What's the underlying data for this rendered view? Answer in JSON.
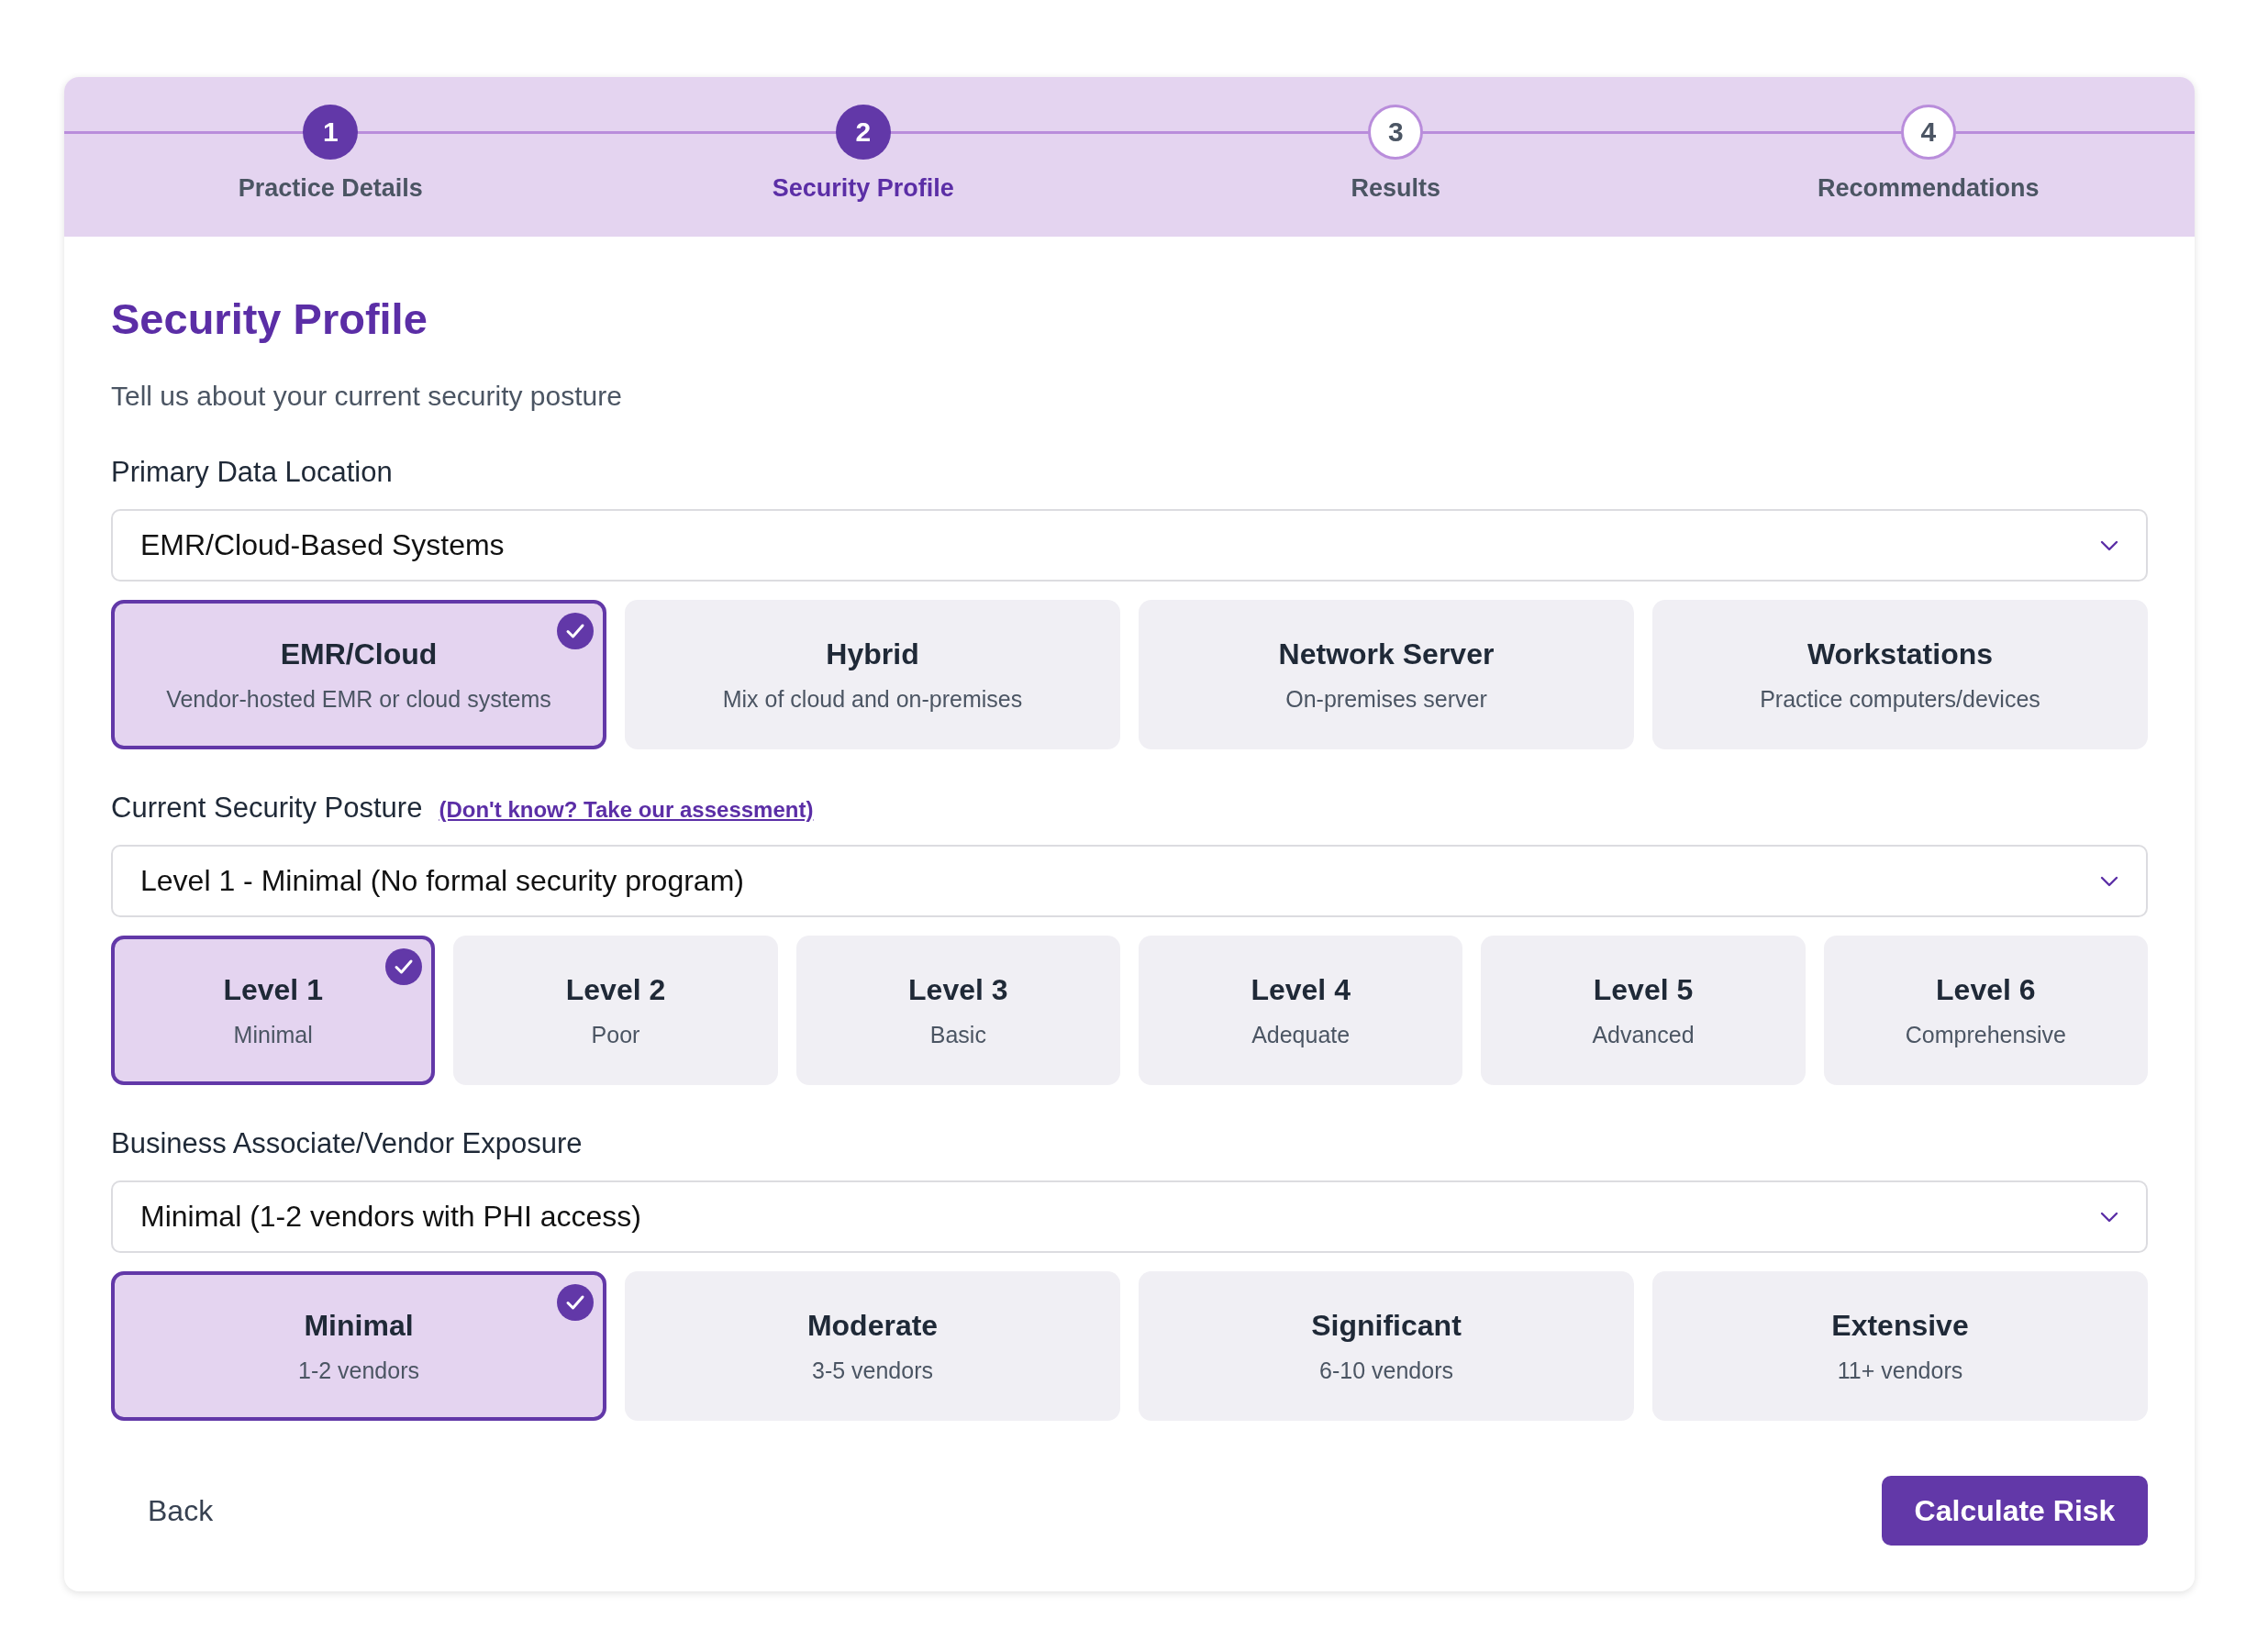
{
  "steps": [
    {
      "number": "1",
      "label": "Practice Details",
      "reached": true,
      "selected": false
    },
    {
      "number": "2",
      "label": "Security Profile",
      "reached": true,
      "selected": true
    },
    {
      "number": "3",
      "label": "Results",
      "reached": false,
      "selected": false
    },
    {
      "number": "4",
      "label": "Recommendations",
      "reached": false,
      "selected": false
    }
  ],
  "heading": "Security Profile",
  "subtitle": "Tell us about your current security posture",
  "sections": [
    {
      "label": "Primary Data Location",
      "value": "EMR/Cloud-Based Systems",
      "options": [
        {
          "title": "EMR/Cloud",
          "subtitle": "Vendor-hosted EMR or cloud systems",
          "selected": true
        },
        {
          "title": "Hybrid",
          "subtitle": "Mix of cloud and on-premises",
          "selected": false
        },
        {
          "title": "Network Server",
          "subtitle": "On-premises server",
          "selected": false
        },
        {
          "title": "Workstations",
          "subtitle": "Practice computers/devices",
          "selected": false
        }
      ]
    },
    {
      "label": "Current Security Posture",
      "link": "(Don't know? Take our assessment)",
      "value": "Level 1 - Minimal (No formal security program)",
      "options": [
        {
          "title": "Level 1",
          "subtitle": "Minimal",
          "selected": true
        },
        {
          "title": "Level 2",
          "subtitle": "Poor",
          "selected": false
        },
        {
          "title": "Level 3",
          "subtitle": "Basic",
          "selected": false
        },
        {
          "title": "Level 4",
          "subtitle": "Adequate",
          "selected": false
        },
        {
          "title": "Level 5",
          "subtitle": "Advanced",
          "selected": false
        },
        {
          "title": "Level 6",
          "subtitle": "Comprehensive",
          "selected": false
        }
      ]
    },
    {
      "label": "Business Associate/Vendor Exposure",
      "value": "Minimal (1-2 vendors with PHI access)",
      "options": [
        {
          "title": "Minimal",
          "subtitle": "1-2 vendors",
          "selected": true
        },
        {
          "title": "Moderate",
          "subtitle": "3-5 vendors",
          "selected": false
        },
        {
          "title": "Significant",
          "subtitle": "6-10 vendors",
          "selected": false
        },
        {
          "title": "Extensive",
          "subtitle": "11+ vendors",
          "selected": false
        }
      ]
    }
  ],
  "back_button": "Back",
  "submit_button": "Calculate Risk"
}
